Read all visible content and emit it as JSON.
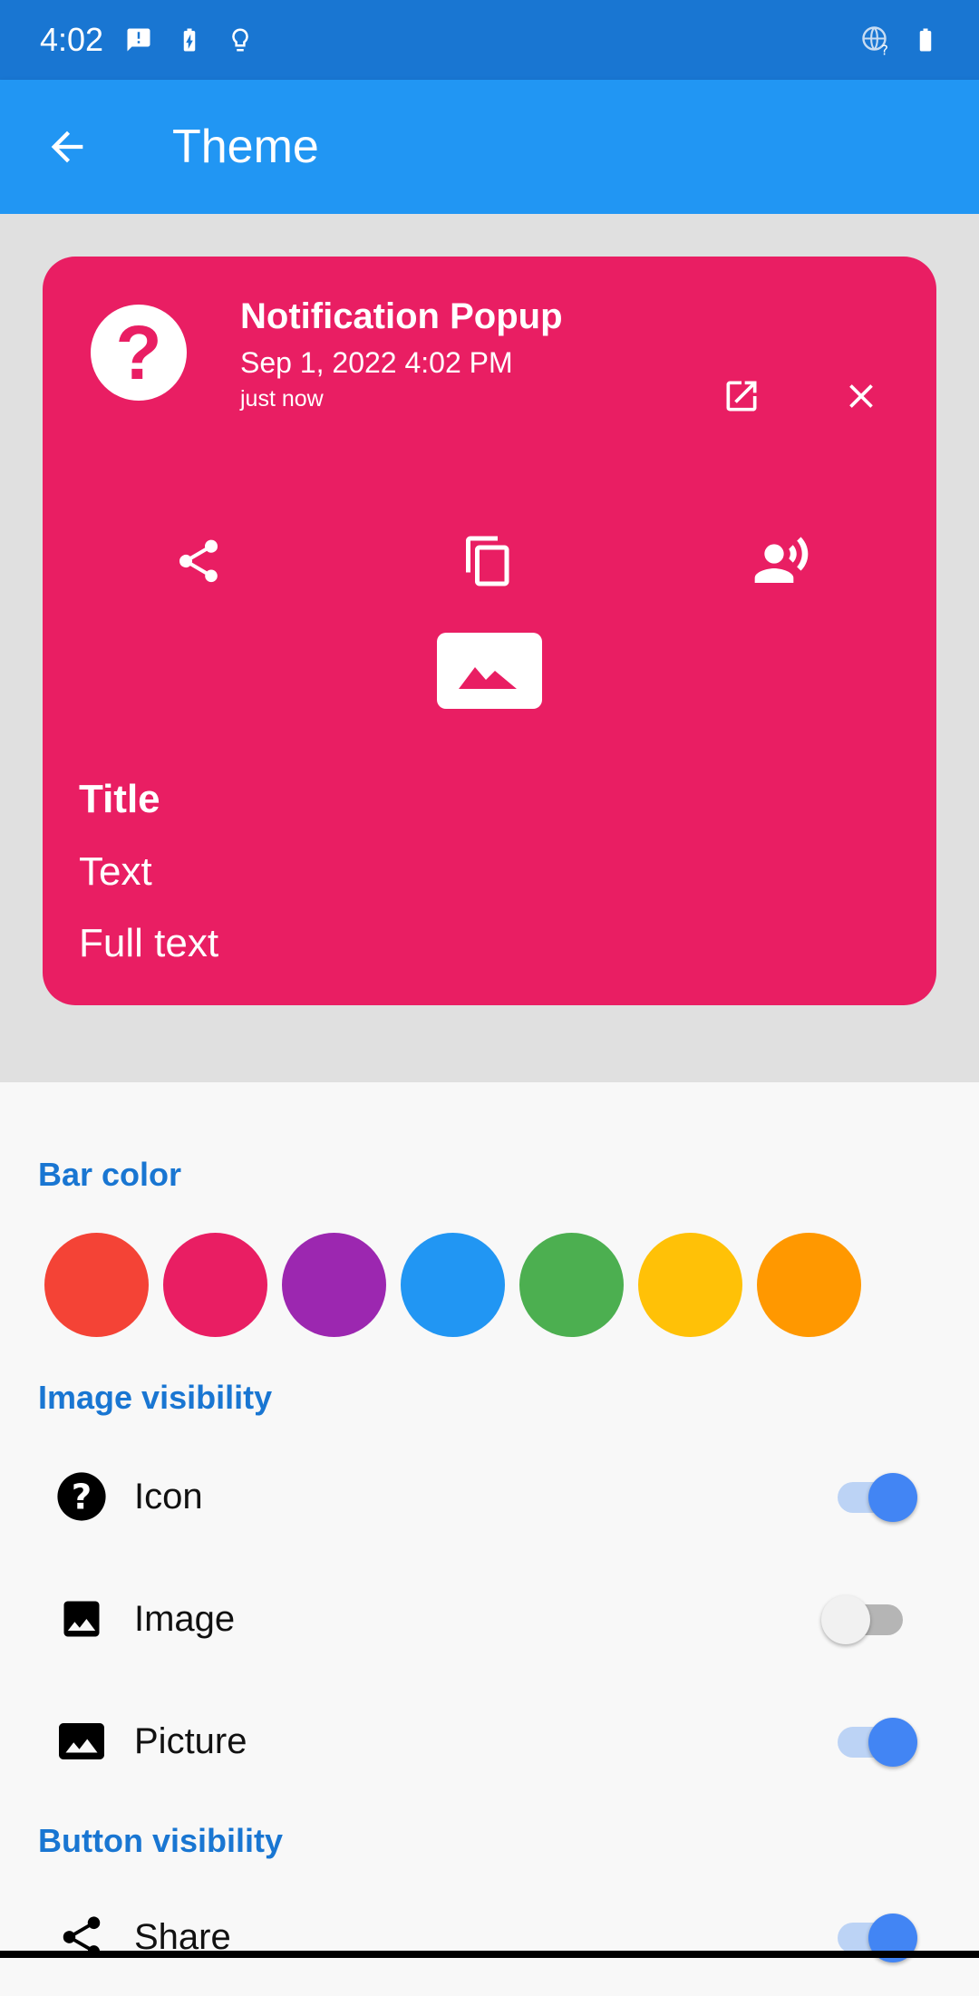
{
  "status_bar": {
    "time": "4:02"
  },
  "app_bar": {
    "title": "Theme"
  },
  "card": {
    "title": "Notification Popup",
    "date": "Sep 1, 2022 4:02 PM",
    "ago": "just now",
    "icon_glyph": "?",
    "body_title": "Title",
    "body_text": "Text",
    "body_full_text": "Full text",
    "background": "#e91e63"
  },
  "bar_color": {
    "label": "Bar color",
    "colors": [
      "#f44336",
      "#e91e63",
      "#9c27b0",
      "#2196f3",
      "#4caf50",
      "#ffc107",
      "#ff9800"
    ]
  },
  "image_visibility": {
    "label": "Image visibility",
    "items": [
      {
        "label": "Icon",
        "icon": "help-circle-icon",
        "enabled": true
      },
      {
        "label": "Image",
        "icon": "image-icon",
        "enabled": false
      },
      {
        "label": "Picture",
        "icon": "picture-icon",
        "enabled": true
      }
    ]
  },
  "button_visibility": {
    "label": "Button visibility",
    "items": [
      {
        "label": "Share",
        "icon": "share-icon",
        "enabled": true
      }
    ]
  }
}
